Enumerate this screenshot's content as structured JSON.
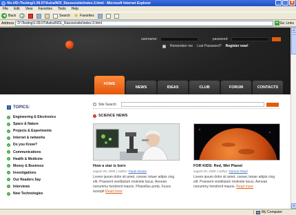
{
  "window": {
    "title": "file:///D:/Testing/1.09.07/Astra/NOl_Ranzes/site/index-3.html - Microsoft Internet Explorer",
    "minimize": "_",
    "maximize": "□",
    "close": "X"
  },
  "menu": [
    "File",
    "Edit",
    "View",
    "Favorites",
    "Tools",
    "Help"
  ],
  "toolbar": {
    "back": "Back",
    "search": "Search",
    "favorites": "Favorites"
  },
  "address": {
    "label": "Address",
    "value": "D:\\Testing\\1.09.07\\Astra\\NOL_Ranzes\\site\\index-3.html",
    "go": "Go",
    "links": "Links"
  },
  "login": {
    "username_label": "username:",
    "password_label": "password:",
    "remember": "Remember me",
    "lost_password": "Lost Password?",
    "register": "Register now!"
  },
  "nav": [
    "HOME",
    "NEWS",
    "IDEAS",
    "CLUB",
    "FORUM",
    "CONTACTS"
  ],
  "sidebar": {
    "heading": "TOPICS:",
    "items": [
      "Engineering & Electronics",
      "Space & Nature",
      "Projects & Experiments",
      "Internet & networks",
      "Do you Know?",
      "Communications",
      "Health & Medicine",
      "Money & Business",
      "Investigations",
      "Our Readers Say",
      "Interviews",
      "New Technologies"
    ]
  },
  "search": {
    "label": "Site Search"
  },
  "news": {
    "heading": "SCIENCE NEWS",
    "articles": [
      {
        "title": "How a star is born",
        "date": "august 05, 2008",
        "author_label": "Author:",
        "author": "Paulo Master",
        "body": "Lorem ipsum dolor sit amet, consec tetuer adipis cing elit. Praesent vestibulum molestie lacus. Aenean nonummy hendrerit mauris. Phasellus porta. Fusce suscipit",
        "readmore": "Read more"
      },
      {
        "title": "FOR KIDS: Red, Wet Planet",
        "date": "august 05, 2008",
        "author_label": "Author:",
        "author": "Darrent Reed",
        "body": "Lorem ipsum dolor sit amet, consec tetuer adipis cing elit. Praesent vestibulum molestie lacus. Aenean nonummy hendrerit mauris.",
        "readmore": "Read more"
      }
    ]
  },
  "status": {
    "left": "",
    "zone": "My Computer"
  },
  "colors": {
    "accent": "#e35a10",
    "header": "#222222",
    "bullet": "#3ba33b"
  }
}
